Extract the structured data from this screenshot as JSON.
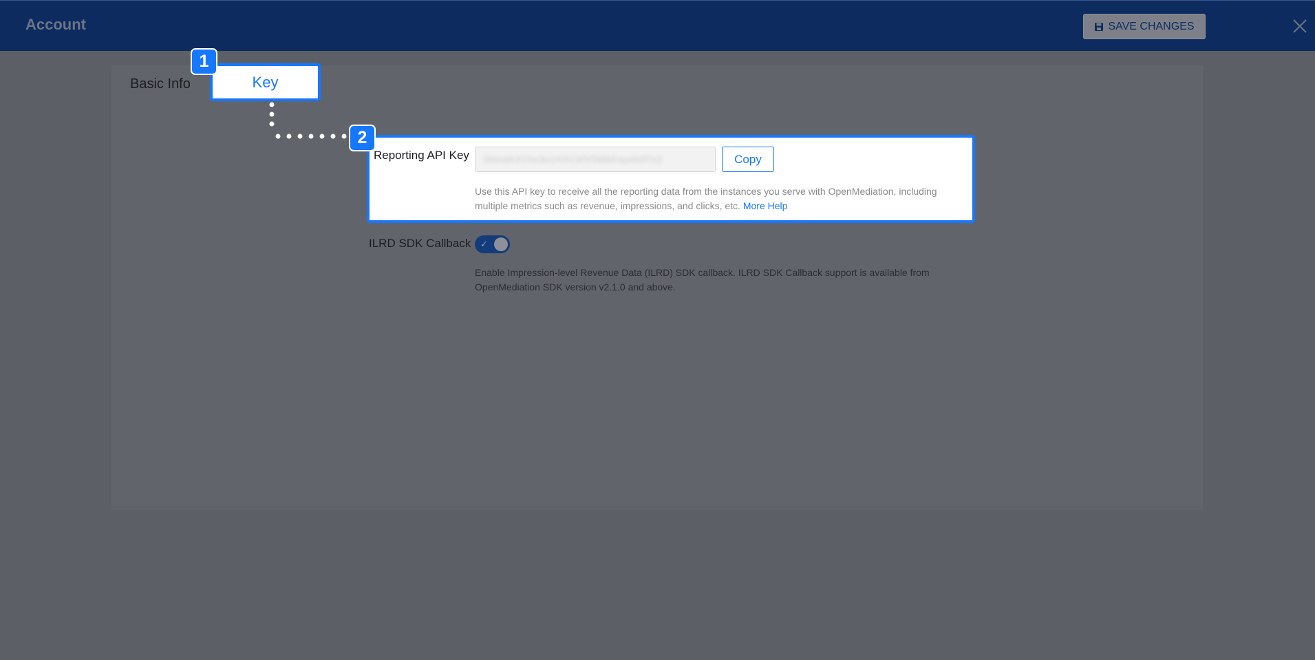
{
  "header": {
    "title": "Account",
    "save_label": "SAVE CHANGES",
    "save_icon": "floppy-disk-icon",
    "close_icon": "close-icon"
  },
  "tabs": {
    "basic_info": "Basic Info",
    "key": "Key"
  },
  "callouts": {
    "step1": "1",
    "step2": "2"
  },
  "reporting": {
    "label": "Reporting API Key",
    "value_masked": "0mnaK4Yhs3o1HXCkfVSMbFayxkdTn3",
    "copy_label": "Copy",
    "help_text": "Use this API key to receive all the reporting data from the instances you serve with OpenMediation, including multiple metrics such as revenue, impressions, and clicks, etc.",
    "help_link": "More Help"
  },
  "ilrd": {
    "label": "ILRD SDK Callback",
    "enabled": true,
    "help_text": "Enable Impression-level Revenue Data (ILRD) SDK callback. ILRD SDK Callback support is available from OpenMediation SDK version v2.1.0 and above."
  },
  "colors": {
    "accent": "#1677ff",
    "header_bg": "#0d2b5e",
    "overlay": "#5d5f66"
  }
}
